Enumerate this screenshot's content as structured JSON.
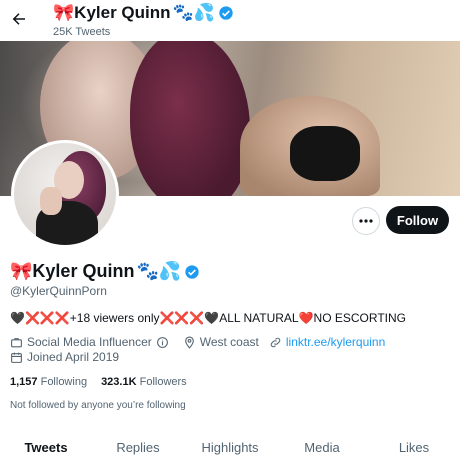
{
  "header": {
    "back_label": "←",
    "name": "Kyler Quinn",
    "tweet_count": "25K Tweets"
  },
  "profile": {
    "name_prefix_emoji": "🎀",
    "name": "Kyler Quinn",
    "name_suffix_emoji": "🐾💦",
    "handle": "@KylerQuinnPorn",
    "bio": "🖤❌❌❌+18 viewers only❌❌❌🖤ALL NATURAL❤️NO ESCORTING",
    "category": "Social Media Influencer",
    "location": "West coast",
    "link": "linktr.ee/kylerquinn",
    "joined": "Joined April 2019",
    "following_count": "1,157",
    "following_label": "Following",
    "followers_count": "323.1K",
    "followers_label": "Followers",
    "not_followed": "Not followed by anyone you’re following"
  },
  "actions": {
    "more_label": "···",
    "follow_label": "Follow"
  },
  "tabs": [
    {
      "label": "Tweets"
    },
    {
      "label": "Replies"
    },
    {
      "label": "Highlights"
    },
    {
      "label": "Media"
    },
    {
      "label": "Likes"
    }
  ],
  "colors": {
    "accent": "#1d9bf0",
    "text": "#0f1419",
    "muted": "#536471"
  }
}
